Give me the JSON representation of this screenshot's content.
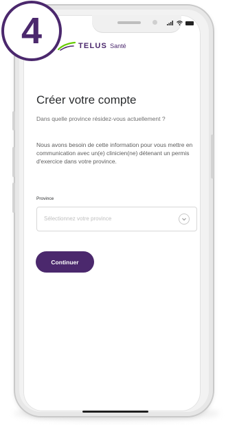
{
  "step_badge": {
    "number": "4"
  },
  "brand": {
    "name": "TELUS",
    "suffix": "Santé",
    "color": "#4b286d"
  },
  "page": {
    "title": "Créer votre compte",
    "question": "Dans quelle province résidez-vous actuellement ?",
    "explanation": "Nous avons besoin de cette information pour vous mettre en communication avec un(e) clinicien(ne) détenant un permis d'exercice dans votre province."
  },
  "form": {
    "province_label": "Province",
    "province_placeholder": "Sélectionnez votre province"
  },
  "buttons": {
    "continue_label": "Continuer"
  }
}
